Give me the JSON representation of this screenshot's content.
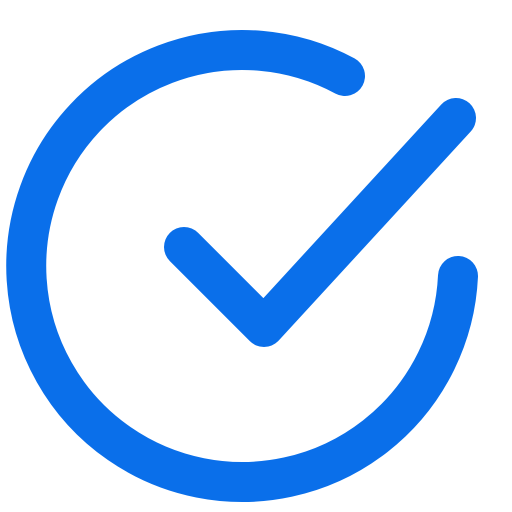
{
  "icon": {
    "name": "check-circle-icon",
    "color": "#0A6FEA"
  }
}
